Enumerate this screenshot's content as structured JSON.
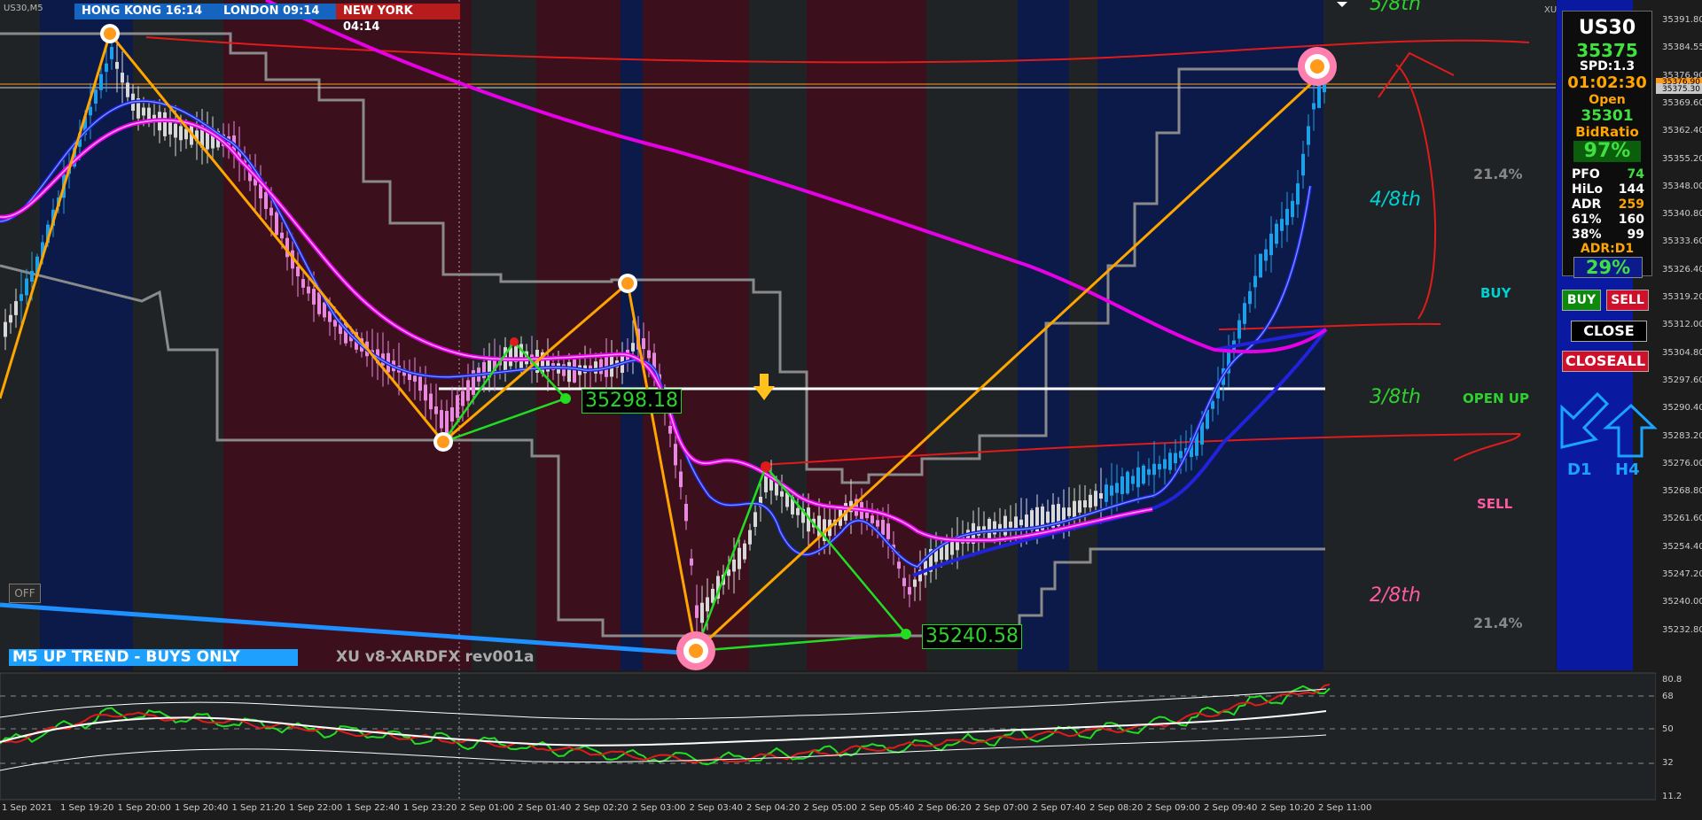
{
  "symbol": "US30,M5",
  "corner_tag": "XU",
  "clocks": [
    {
      "label": "HONG KONG 16:14",
      "bg": "#1565c0"
    },
    {
      "label": "LONDON 09:14",
      "bg": "#1565c0"
    },
    {
      "label": "NEW YORK 04:14",
      "bg": "#b71c1c"
    }
  ],
  "off_button": "OFF",
  "trend_banner": "M5 UP TREND - BUYS ONLY",
  "brand": "XU v8-XARDFX rev001a",
  "levels": {
    "top": "5/8th",
    "l48": "4/8th",
    "l38": "3/8th",
    "l28": "2/8th"
  },
  "signals": {
    "buy": "BUY",
    "open_up": "OPEN UP",
    "sell": "SELL"
  },
  "pcts": {
    "upper": "21.4%",
    "lower": "21.4%"
  },
  "price_labels": {
    "a": "35298.18",
    "b": "35240.58"
  },
  "panel": {
    "symbol": "US30",
    "price": "35375",
    "spread": "SPD:1.3",
    "timer": "01:02:30",
    "open_label": "Open",
    "open_value": "35301",
    "bid_label": "BidRatio",
    "bid_value": "97%",
    "rows": [
      {
        "k": "PFO",
        "v": "74",
        "c": "#3fe03f"
      },
      {
        "k": "HiLo",
        "v": "144",
        "c": "#ffffff"
      },
      {
        "k": "ADR",
        "v": "259",
        "c": "#ffa500"
      },
      {
        "k": "61%",
        "v": "160",
        "c": "#ffffff"
      },
      {
        "k": "38%",
        "v": "99",
        "c": "#ffffff"
      }
    ],
    "adr_label": "ADR:D1",
    "adr_value": "29%"
  },
  "buttons": {
    "buy": "BUY",
    "sell": "SELL",
    "close": "CLOSE",
    "closeall": "CLOSEALL"
  },
  "arrows": {
    "d1": "D1",
    "h4": "H4"
  },
  "price_axis": [
    "35391.80",
    "35384.55",
    "35376.90",
    "35369.60",
    "35362.40",
    "35355.20",
    "35348.00",
    "35340.80",
    "35333.60",
    "35326.40",
    "35319.20",
    "35312.00",
    "35304.80",
    "35297.60",
    "35290.40",
    "35283.20",
    "35276.00",
    "35268.80",
    "35261.60",
    "35254.40",
    "35247.20",
    "35240.00",
    "35232.80"
  ],
  "price_axis_markers": [
    "35376.90",
    "35375.30"
  ],
  "osc_axis": [
    "80.8",
    "68",
    "50",
    "32",
    "11.2"
  ],
  "time_axis": [
    "1 Sep 2021",
    "1 Sep 19:20",
    "1 Sep 20:00",
    "1 Sep 20:40",
    "1 Sep 21:20",
    "1 Sep 22:00",
    "1 Sep 22:40",
    "1 Sep 23:20",
    "2 Sep 01:00",
    "2 Sep 01:40",
    "2 Sep 02:20",
    "2 Sep 03:00",
    "2 Sep 03:40",
    "2 Sep 04:20",
    "2 Sep 05:00",
    "2 Sep 05:40",
    "2 Sep 06:20",
    "2 Sep 07:00",
    "2 Sep 07:40",
    "2 Sep 08:20",
    "2 Sep 09:00",
    "2 Sep 09:40",
    "2 Sep 10:20",
    "2 Sep 11:00"
  ],
  "colors": {
    "bull_candle": "#1ea0e8",
    "bear_candle": "#e889e0",
    "neutral_candle": "#d8d8d8",
    "ema_fast": "#2222dd",
    "ema_slow": "#e600e6",
    "zigzag": "#ffa500",
    "pattern": "#22dd22",
    "asia_bg": "#0a1a4a",
    "london_bg": "#3a0f1a",
    "panel_bg": "#0d1a8c"
  }
}
